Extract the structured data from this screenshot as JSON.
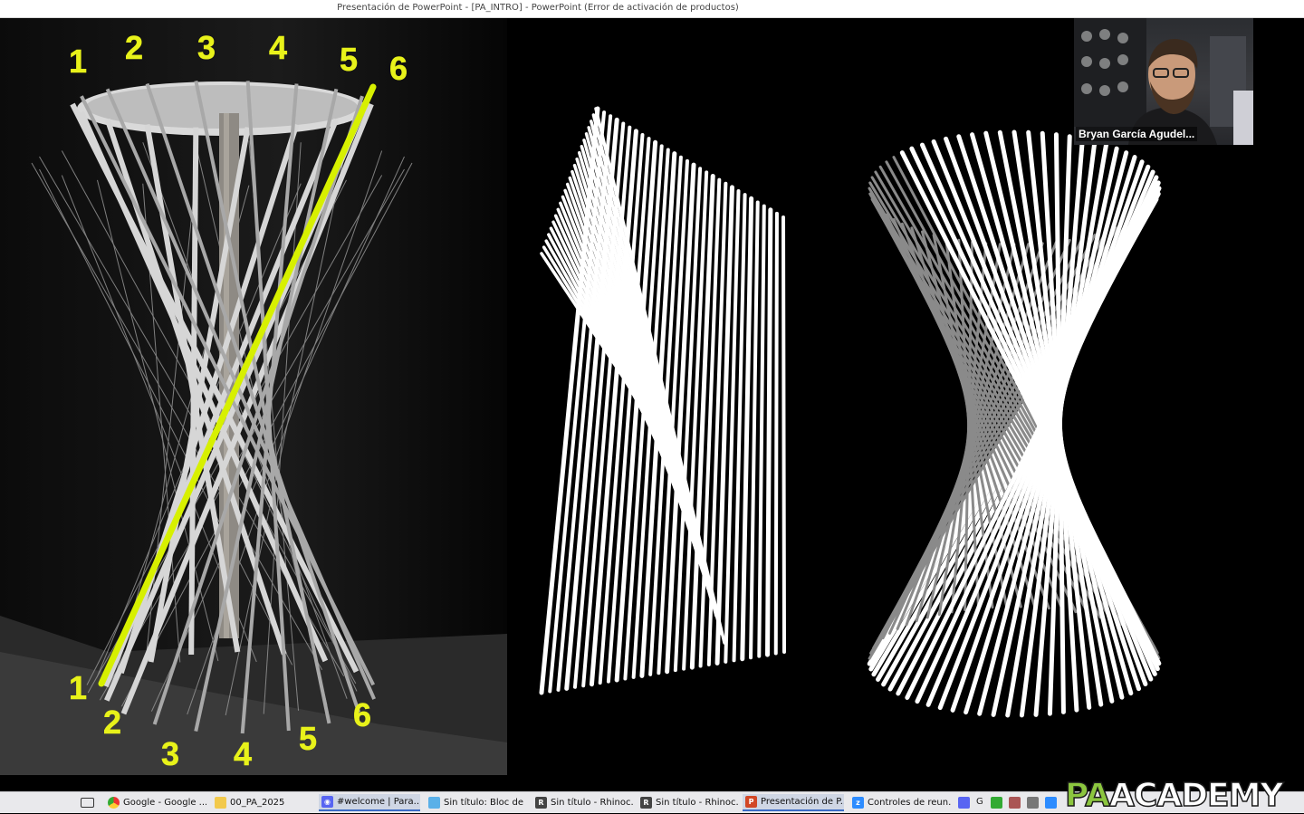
{
  "window": {
    "title": "Presentación de PowerPoint - [PA_INTRO] - PowerPoint (Error de activación de productos)"
  },
  "slide": {
    "photo_labels_top": [
      "1",
      "2",
      "3",
      "4",
      "5",
      "6"
    ],
    "photo_labels_bottom": [
      "1",
      "2",
      "3",
      "4",
      "5",
      "6"
    ],
    "highlight_color": "#d7f000",
    "label_color": "#e8f21a"
  },
  "video": {
    "participant_name": "Bryan García Agudel..."
  },
  "taskbar": {
    "items": [
      {
        "label": "Google - Google ...",
        "icon": "chrome-icon"
      },
      {
        "label": "00_PA_2025",
        "icon": "folder-icon"
      },
      {
        "label": "#welcome | Para...",
        "icon": "discord-icon"
      },
      {
        "label": "Sin título: Bloc de ...",
        "icon": "notepad-icon"
      },
      {
        "label": "Sin título - Rhinoc...",
        "icon": "rhino-icon"
      },
      {
        "label": "Sin título - Rhinoc...",
        "icon": "rhino-icon"
      },
      {
        "label": "Presentación de P...",
        "icon": "powerpoint-icon"
      },
      {
        "label": "Controles de reun...",
        "icon": "zoom-icon"
      }
    ],
    "tray_text": "G"
  },
  "watermark": {
    "logo_pa": "PA",
    "logo_academy": "ACADEMY"
  }
}
